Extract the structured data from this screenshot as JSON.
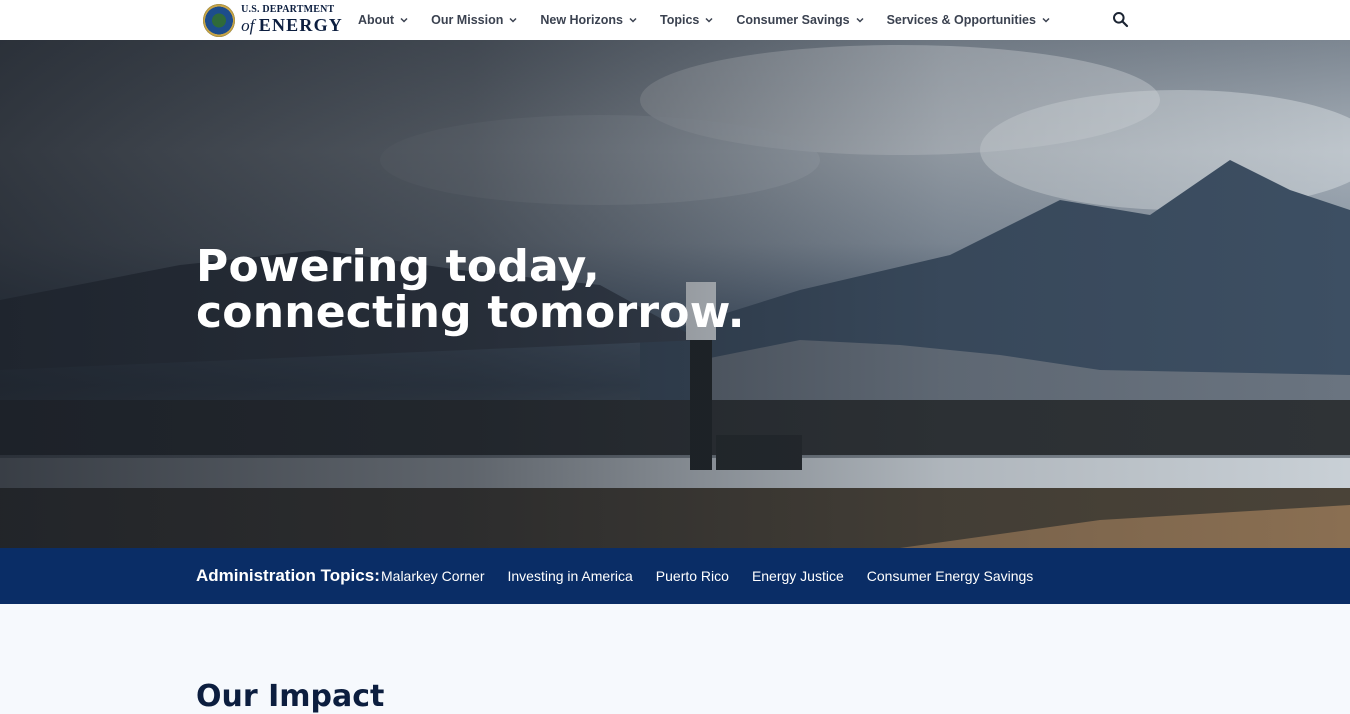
{
  "header": {
    "logo": {
      "line1": "U.S. DEPARTMENT",
      "of": "of",
      "energy": "ENERGY"
    },
    "nav": [
      {
        "label": "About"
      },
      {
        "label": "Our Mission"
      },
      {
        "label": "New Horizons"
      },
      {
        "label": "Topics"
      },
      {
        "label": "Consumer Savings"
      },
      {
        "label": "Services & Opportunities"
      }
    ],
    "search_icon": "search-icon"
  },
  "hero": {
    "title_line1": "Powering today,",
    "title_line2": "connecting tomorrow."
  },
  "admin_topics": {
    "label": "Administration Topics:",
    "links": [
      {
        "label": "Malarkey Corner"
      },
      {
        "label": "Investing in America"
      },
      {
        "label": "Puerto Rico"
      },
      {
        "label": "Energy Justice"
      },
      {
        "label": "Consumer Energy Savings"
      }
    ]
  },
  "section": {
    "heading": "Our Impact"
  },
  "colors": {
    "topics_bar": "#0a2d66",
    "heading": "#0c1e3f"
  }
}
